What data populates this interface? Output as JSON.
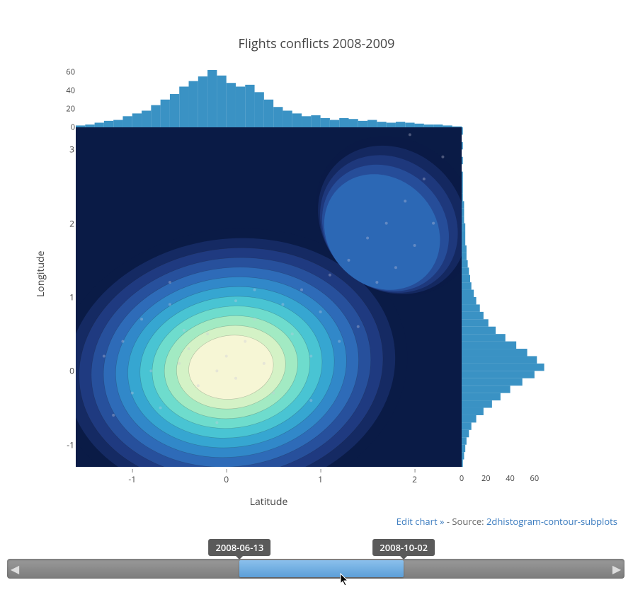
{
  "title": "Flights conflicts 2008-2009",
  "xlabel": "Latitude",
  "ylabel": "Longitude",
  "footer": {
    "edit_link": "Edit chart »",
    "source_label": " - Source: ",
    "source_name": "2dhistogram-contour-subplots"
  },
  "slider": {
    "start_label": "2008-06-13",
    "end_label": "2008-10-02",
    "start_frac": 0.37,
    "end_frac": 0.65
  },
  "chart_data": {
    "type": "heatmap",
    "description": "2D histogram contour with marginal histograms",
    "xlim": [
      -1.6,
      2.5
    ],
    "ylim": [
      -1.3,
      3.3
    ],
    "x_ticks": [
      -1,
      0,
      1,
      2
    ],
    "y_ticks": [
      -1,
      0,
      1,
      2,
      3
    ],
    "top_hist": {
      "axis": "Latitude",
      "ylim": [
        0,
        65
      ],
      "ticks": [
        0,
        20,
        40,
        60
      ],
      "bins": [
        {
          "x": -1.55,
          "count": 2
        },
        {
          "x": -1.45,
          "count": 3
        },
        {
          "x": -1.35,
          "count": 5
        },
        {
          "x": -1.25,
          "count": 7
        },
        {
          "x": -1.15,
          "count": 8
        },
        {
          "x": -1.05,
          "count": 12
        },
        {
          "x": -0.95,
          "count": 15
        },
        {
          "x": -0.85,
          "count": 18
        },
        {
          "x": -0.75,
          "count": 24
        },
        {
          "x": -0.65,
          "count": 30
        },
        {
          "x": -0.55,
          "count": 36
        },
        {
          "x": -0.45,
          "count": 44
        },
        {
          "x": -0.35,
          "count": 50
        },
        {
          "x": -0.25,
          "count": 55
        },
        {
          "x": -0.15,
          "count": 62
        },
        {
          "x": -0.05,
          "count": 56
        },
        {
          "x": 0.05,
          "count": 48
        },
        {
          "x": 0.15,
          "count": 44
        },
        {
          "x": 0.25,
          "count": 46
        },
        {
          "x": 0.35,
          "count": 38
        },
        {
          "x": 0.45,
          "count": 30
        },
        {
          "x": 0.55,
          "count": 22
        },
        {
          "x": 0.65,
          "count": 18
        },
        {
          "x": 0.75,
          "count": 15
        },
        {
          "x": 0.85,
          "count": 12
        },
        {
          "x": 0.95,
          "count": 13
        },
        {
          "x": 1.05,
          "count": 10
        },
        {
          "x": 1.15,
          "count": 8
        },
        {
          "x": 1.25,
          "count": 10
        },
        {
          "x": 1.35,
          "count": 9
        },
        {
          "x": 1.45,
          "count": 7
        },
        {
          "x": 1.55,
          "count": 8
        },
        {
          "x": 1.65,
          "count": 6
        },
        {
          "x": 1.75,
          "count": 5
        },
        {
          "x": 1.85,
          "count": 6
        },
        {
          "x": 1.95,
          "count": 5
        },
        {
          "x": 2.05,
          "count": 4
        },
        {
          "x": 2.15,
          "count": 3
        },
        {
          "x": 2.25,
          "count": 3
        },
        {
          "x": 2.35,
          "count": 2
        },
        {
          "x": 2.45,
          "count": 1
        }
      ]
    },
    "right_hist": {
      "axis": "Longitude",
      "xlim": [
        0,
        70
      ],
      "ticks": [
        0,
        20,
        40,
        60
      ],
      "bins": [
        {
          "y": -1.25,
          "count": 1
        },
        {
          "y": -1.15,
          "count": 2
        },
        {
          "y": -1.05,
          "count": 3
        },
        {
          "y": -0.95,
          "count": 4
        },
        {
          "y": -0.85,
          "count": 6
        },
        {
          "y": -0.75,
          "count": 8
        },
        {
          "y": -0.65,
          "count": 12
        },
        {
          "y": -0.55,
          "count": 18
        },
        {
          "y": -0.45,
          "count": 25
        },
        {
          "y": -0.35,
          "count": 32
        },
        {
          "y": -0.25,
          "count": 40
        },
        {
          "y": -0.15,
          "count": 50
        },
        {
          "y": -0.05,
          "count": 60
        },
        {
          "y": 0.05,
          "count": 68
        },
        {
          "y": 0.15,
          "count": 62
        },
        {
          "y": 0.25,
          "count": 54
        },
        {
          "y": 0.35,
          "count": 45
        },
        {
          "y": 0.45,
          "count": 36
        },
        {
          "y": 0.55,
          "count": 28
        },
        {
          "y": 0.65,
          "count": 22
        },
        {
          "y": 0.75,
          "count": 18
        },
        {
          "y": 0.85,
          "count": 15
        },
        {
          "y": 0.95,
          "count": 12
        },
        {
          "y": 1.05,
          "count": 10
        },
        {
          "y": 1.15,
          "count": 8
        },
        {
          "y": 1.25,
          "count": 7
        },
        {
          "y": 1.35,
          "count": 6
        },
        {
          "y": 1.45,
          "count": 5
        },
        {
          "y": 1.55,
          "count": 4
        },
        {
          "y": 1.65,
          "count": 4
        },
        {
          "y": 1.75,
          "count": 3
        },
        {
          "y": 1.85,
          "count": 3
        },
        {
          "y": 1.95,
          "count": 3
        },
        {
          "y": 2.05,
          "count": 2
        },
        {
          "y": 2.15,
          "count": 2
        },
        {
          "y": 2.25,
          "count": 2
        },
        {
          "y": 2.35,
          "count": 1
        },
        {
          "y": 2.45,
          "count": 1
        },
        {
          "y": 2.55,
          "count": 1
        },
        {
          "y": 2.65,
          "count": 1
        },
        {
          "y": 2.85,
          "count": 1
        },
        {
          "y": 3.05,
          "count": 1
        },
        {
          "y": 3.25,
          "count": 1
        }
      ]
    },
    "contours": {
      "center": {
        "x": 0.05,
        "y": 0.05
      },
      "levels": 12,
      "colormap": [
        "#0a1b46",
        "#152a63",
        "#1f3a80",
        "#27509c",
        "#2e6bb8",
        "#3188c9",
        "#36a6d1",
        "#49c4d3",
        "#6edccd",
        "#a2eac3",
        "#d4f2c6",
        "#f6f6d5"
      ]
    },
    "scatter_sample": [
      {
        "x": -1.3,
        "y": 0.2
      },
      {
        "x": -1.1,
        "y": 0.4
      },
      {
        "x": -1.0,
        "y": -0.3
      },
      {
        "x": -0.9,
        "y": 0.7
      },
      {
        "x": -0.8,
        "y": 0.0
      },
      {
        "x": -0.7,
        "y": -0.5
      },
      {
        "x": -0.6,
        "y": 0.9
      },
      {
        "x": -0.5,
        "y": 0.1
      },
      {
        "x": -0.4,
        "y": 0.3
      },
      {
        "x": -0.3,
        "y": -0.2
      },
      {
        "x": -0.2,
        "y": 0.5
      },
      {
        "x": -0.1,
        "y": 0.0
      },
      {
        "x": 0.0,
        "y": 0.2
      },
      {
        "x": 0.1,
        "y": -0.1
      },
      {
        "x": 0.2,
        "y": 0.4
      },
      {
        "x": 0.3,
        "y": 0.7
      },
      {
        "x": 0.4,
        "y": 0.1
      },
      {
        "x": 0.5,
        "y": -0.3
      },
      {
        "x": 0.6,
        "y": 0.9
      },
      {
        "x": 0.7,
        "y": 0.5
      },
      {
        "x": 0.8,
        "y": 1.1
      },
      {
        "x": 0.9,
        "y": 0.2
      },
      {
        "x": 1.0,
        "y": 0.8
      },
      {
        "x": 1.1,
        "y": 1.3
      },
      {
        "x": 1.2,
        "y": 0.4
      },
      {
        "x": 1.3,
        "y": 1.5
      },
      {
        "x": 1.4,
        "y": 0.6
      },
      {
        "x": 1.5,
        "y": 1.8
      },
      {
        "x": 1.6,
        "y": 1.2
      },
      {
        "x": 1.7,
        "y": 2.0
      },
      {
        "x": 1.8,
        "y": 1.4
      },
      {
        "x": 1.9,
        "y": 2.3
      },
      {
        "x": 2.0,
        "y": 1.7
      },
      {
        "x": 2.1,
        "y": 2.6
      },
      {
        "x": 2.2,
        "y": 2.0
      },
      {
        "x": 2.3,
        "y": 2.9
      },
      {
        "x": 1.95,
        "y": 3.2
      },
      {
        "x": -1.2,
        "y": -0.6
      },
      {
        "x": -0.6,
        "y": 1.2
      },
      {
        "x": 0.3,
        "y": 1.1
      },
      {
        "x": -0.1,
        "y": -0.7
      },
      {
        "x": 0.9,
        "y": -0.4
      },
      {
        "x": 0.1,
        "y": 0.95
      },
      {
        "x": -0.45,
        "y": 0.55
      }
    ]
  }
}
